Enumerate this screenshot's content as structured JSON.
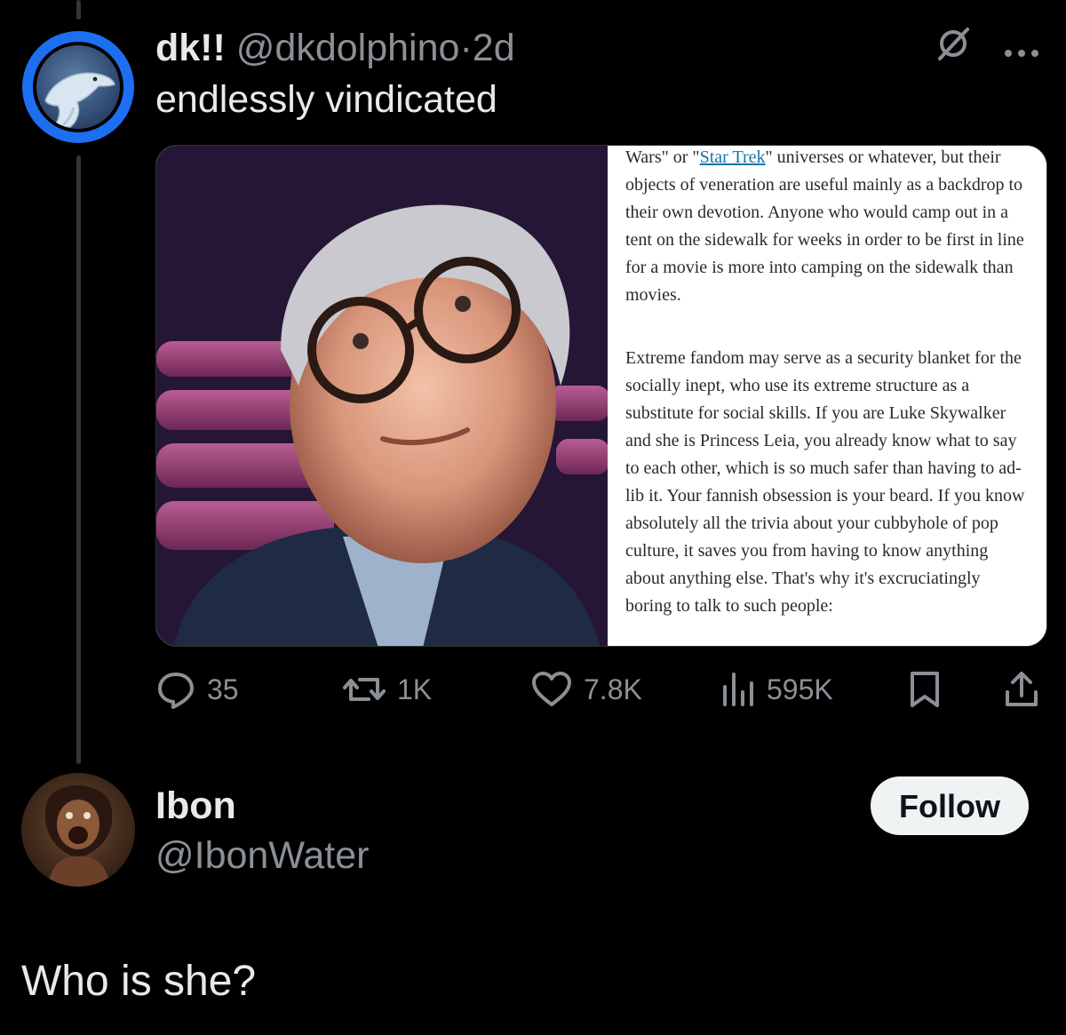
{
  "tweet": {
    "display_name": "dk!!",
    "handle": "@dkdolphino",
    "separator": "·",
    "time": "2d",
    "text": "endlessly vindicated",
    "avatar_icon": "dolphin-avatar",
    "avatar_ring_color": "#1d6ff2",
    "media": {
      "photo_icon": "portrait-photo",
      "article": {
        "p1_before_link": "Wars\" or \"",
        "p1_link": "Star Trek",
        "p1_after_link": "\" universes or whatever, but their objects of veneration are useful mainly as a backdrop to their own devotion. Anyone who would camp out in a tent on the sidewalk for weeks in order to be first in line for a movie is more into camping on the sidewalk than movies.",
        "p2": "Extreme fandom may serve as a security blanket for the socially inept, who use its extreme structure as a substitute for social skills. If you are Luke Skywalker and she is Princess Leia, you already know what to say to each other, which is so much safer than having to ad-lib it. Your fannish obsession is your beard. If you know absolutely all the trivia about your cubbyhole of pop culture, it saves you from having to know anything about anything else. That's why it's excruciatingly boring to talk to such people:"
      }
    },
    "actions": {
      "replies": "35",
      "reposts": "1K",
      "likes": "7.8K",
      "views": "595K"
    }
  },
  "reply": {
    "display_name": "Ibon",
    "handle": "@IbonWater",
    "follow_label": "Follow",
    "text": "Who is she?",
    "avatar_icon": "user-avatar"
  },
  "colors": {
    "background": "#000000",
    "text": "#e7e9ea",
    "muted": "#8b9096",
    "link": "#1a73a8"
  }
}
